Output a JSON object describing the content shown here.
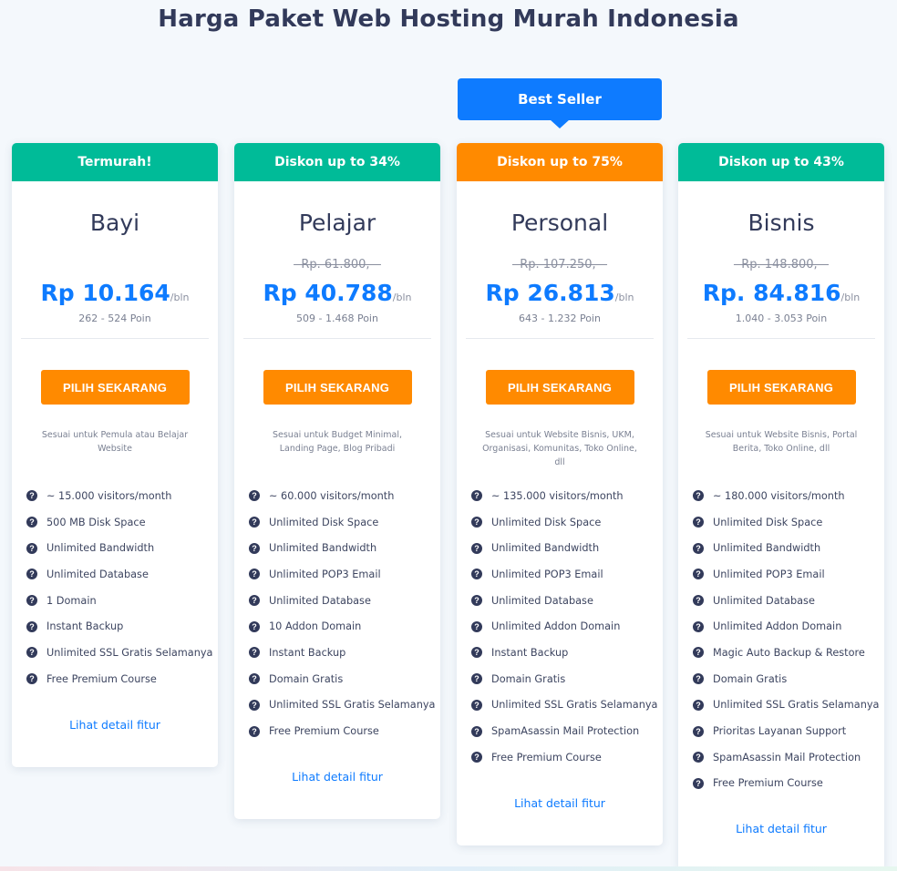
{
  "page": {
    "title": "Harga Paket Web Hosting Murah Indonesia",
    "best_seller": "Best Seller"
  },
  "colors": {
    "green": "#00bb98",
    "orange": "#ff8a00",
    "blue": "#0e7bff",
    "navy": "#323a5a"
  },
  "icons": {
    "feature": "question-circle-icon"
  },
  "plans": [
    {
      "badge": "Termurah!",
      "badge_color": "green",
      "name": "Bayi",
      "old_price": "",
      "price": "Rp 10.164",
      "per": "/bln",
      "points": "262 - 524 Poin",
      "cta": "PILIH SEKARANG",
      "description": "Sesuai untuk Pemula atau Belajar Website",
      "features": [
        "~ 15.000 visitors/month",
        "500 MB Disk Space",
        "Unlimited Bandwidth",
        "Unlimited Database",
        "1 Domain",
        "Instant Backup",
        "Unlimited SSL Gratis Selamanya",
        "Free Premium Course"
      ],
      "detail_link": "Lihat detail fitur"
    },
    {
      "badge": "Diskon up to 34%",
      "badge_color": "green",
      "name": "Pelajar",
      "old_price": "Rp. 61.800,",
      "price": "Rp 40.788",
      "per": "/bln",
      "points": "509 - 1.468 Poin",
      "cta": "PILIH SEKARANG",
      "description": "Sesuai untuk Budget Minimal, Landing Page, Blog Pribadi",
      "features": [
        "~ 60.000 visitors/month",
        "Unlimited Disk Space",
        "Unlimited Bandwidth",
        "Unlimited POP3 Email",
        "Unlimited Database",
        "10 Addon Domain",
        "Instant Backup",
        "Domain Gratis",
        "Unlimited SSL Gratis Selamanya",
        "Free Premium Course"
      ],
      "detail_link": "Lihat detail fitur"
    },
    {
      "badge": "Diskon up to 75%",
      "badge_color": "orange",
      "name": "Personal",
      "old_price": "Rp. 107.250,",
      "price": "Rp 26.813",
      "per": "/bln",
      "points": "643 - 1.232 Poin",
      "cta": "PILIH SEKARANG",
      "description": "Sesuai untuk Website Bisnis, UKM, Organisasi, Komunitas, Toko Online, dll",
      "features": [
        "~ 135.000 visitors/month",
        "Unlimited Disk Space",
        "Unlimited Bandwidth",
        "Unlimited POP3 Email",
        "Unlimited Database",
        "Unlimited Addon Domain",
        "Instant Backup",
        "Domain Gratis",
        "Unlimited SSL Gratis Selamanya",
        "SpamAsassin Mail Protection",
        "Free Premium Course"
      ],
      "detail_link": "Lihat detail fitur"
    },
    {
      "badge": "Diskon up to 43%",
      "badge_color": "green",
      "name": "Bisnis",
      "old_price": "Rp. 148.800,",
      "price": "Rp. 84.816",
      "per": "/bln",
      "points": "1.040 - 3.053 Poin",
      "cta": "PILIH SEKARANG",
      "description": "Sesuai untuk Website Bisnis, Portal Berita, Toko Online, dll",
      "features": [
        "~ 180.000 visitors/month",
        "Unlimited Disk Space",
        "Unlimited Bandwidth",
        "Unlimited POP3 Email",
        "Unlimited Database",
        "Unlimited Addon Domain",
        "Magic Auto Backup & Restore",
        "Domain Gratis",
        "Unlimited SSL Gratis Selamanya",
        "Prioritas Layanan Support",
        "SpamAsassin Mail Protection",
        "Free Premium Course"
      ],
      "detail_link": "Lihat detail fitur"
    }
  ]
}
